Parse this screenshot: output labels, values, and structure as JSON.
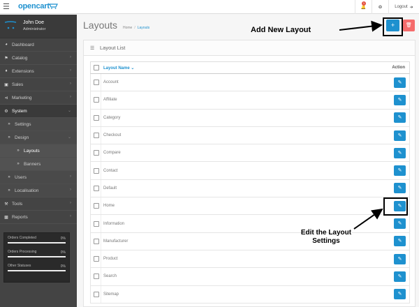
{
  "header": {
    "logo_text": "opencart",
    "notifications_count": "1",
    "logout_label": "Logout"
  },
  "profile": {
    "name": "John Doe",
    "role": "Administrator"
  },
  "sidebar": {
    "items": [
      {
        "label": "Dashboard",
        "icon": "dashboard-icon"
      },
      {
        "label": "Catalog",
        "icon": "tag-icon"
      },
      {
        "label": "Extensions",
        "icon": "puzzle-icon"
      },
      {
        "label": "Sales",
        "icon": "cart-icon"
      },
      {
        "label": "Marketing",
        "icon": "share-icon"
      },
      {
        "label": "System",
        "icon": "gear-icon"
      }
    ],
    "system_sub": [
      {
        "label": "Settings"
      },
      {
        "label": "Design"
      }
    ],
    "design_sub": [
      {
        "label": "Layouts"
      },
      {
        "label": "Banners"
      }
    ],
    "system_sub_after": [
      {
        "label": "Users"
      },
      {
        "label": "Localisation"
      }
    ],
    "items_after": [
      {
        "label": "Tools",
        "icon": "wrench-icon"
      },
      {
        "label": "Reports",
        "icon": "bar-chart-icon"
      }
    ]
  },
  "stats": [
    {
      "label": "Orders Completed",
      "value": "0%"
    },
    {
      "label": "Orders Processing",
      "value": "0%"
    },
    {
      "label": "Other Statuses",
      "value": "0%"
    }
  ],
  "page": {
    "title": "Layouts",
    "breadcrumb_home": "Home",
    "breadcrumb_current": "Layouts"
  },
  "panel": {
    "title": "Layout List"
  },
  "table": {
    "col_name": "Layout Name",
    "col_action": "Action",
    "rows": [
      "Account",
      "Affiliate",
      "Category",
      "Checkout",
      "Compare",
      "Contact",
      "Default",
      "Home",
      "Information",
      "Manufacturer",
      "Product",
      "Search",
      "Sitemap"
    ]
  },
  "annotations": {
    "add_label": "Add New Layout",
    "edit_label_line1": "Edit the Layout",
    "edit_label_line2": "Settings"
  }
}
